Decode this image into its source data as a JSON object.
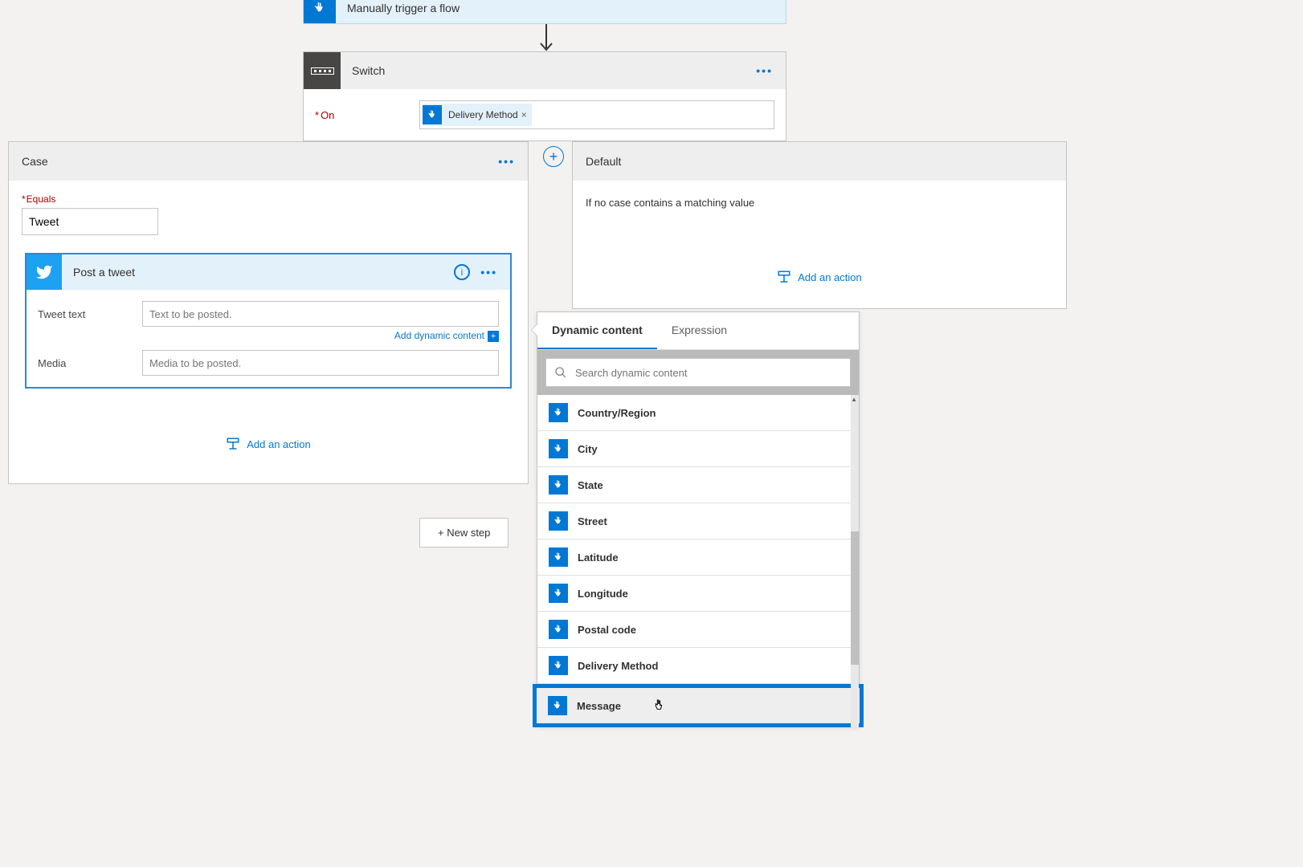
{
  "trigger": {
    "label": "Manually trigger a flow"
  },
  "switch": {
    "title": "Switch",
    "on_label": "On",
    "token_label": "Delivery Method"
  },
  "case": {
    "title": "Case",
    "equals_label": "Equals",
    "equals_value": "Tweet",
    "add_action": "Add an action"
  },
  "tweet": {
    "title": "Post a tweet",
    "text_label": "Tweet text",
    "text_placeholder": "Text to be posted.",
    "media_label": "Media",
    "media_placeholder": "Media to be posted.",
    "add_dynamic": "Add dynamic content"
  },
  "default": {
    "title": "Default",
    "body": "If no case contains a matching value",
    "add_action": "Add an action"
  },
  "new_step": "+ New step",
  "dynamic": {
    "tab_content": "Dynamic content",
    "tab_expression": "Expression",
    "search_placeholder": "Search dynamic content",
    "items": [
      "Country/Region",
      "City",
      "State",
      "Street",
      "Latitude",
      "Longitude",
      "Postal code",
      "Delivery Method",
      "Message"
    ]
  }
}
